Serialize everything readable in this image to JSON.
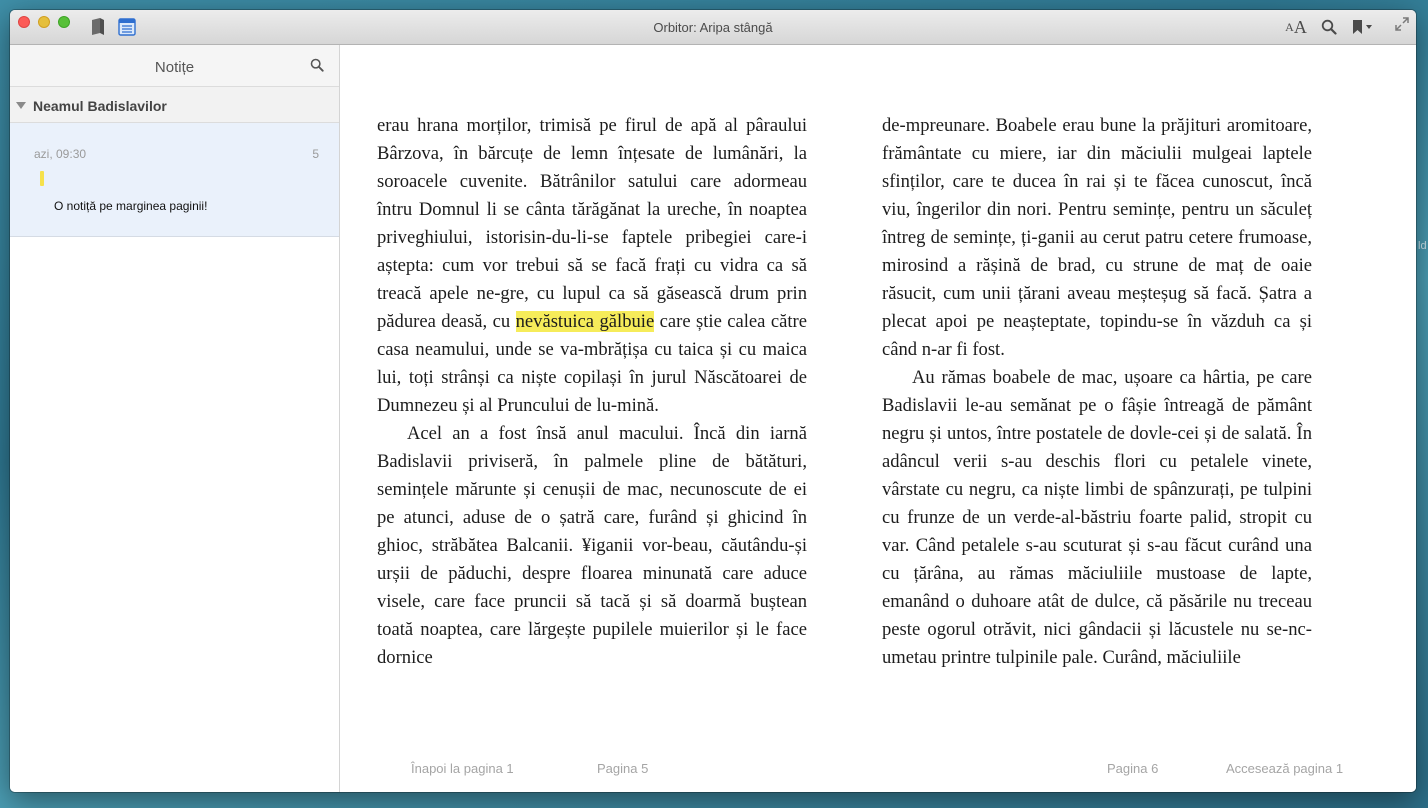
{
  "window": {
    "title": "Orbitor: Aripa stângă",
    "font_size_small": "A",
    "font_size_large": "A"
  },
  "desktop": {
    "fragment": "ld"
  },
  "sidebar": {
    "title": "Notițe",
    "chapter": "Neamul Badislavilor",
    "note": {
      "time": "azi, 09:30",
      "page": "5",
      "highlight_color": "#f6e14b",
      "text": "O notiță pe marginea paginii!"
    }
  },
  "book": {
    "left_page": {
      "p1_before": "erau hrana morților, trimisă pe firul de apă al pâraului Bârzova, în bărcuțe de lemn înțesate de lumânări, la soroacele cuvenite. Bătrânilor satului care adormeau întru Domnul li se cânta tărăgănat la ureche, în noaptea priveghiului, istorisin-du-li-se faptele pribegiei care-i aștepta: cum vor trebui să se facă frați cu vidra ca să treacă apele ne-gre, cu lupul ca să găsească drum prin pădurea deasă, cu",
      "highlight": "nevăstuica gălbuie",
      "p1_after": "care știe calea către casa neamului, unde se va-mbrățișa cu taica și cu maica lui, toți strânși ca niște copilași în jurul Născătoarei de Dumnezeu și al Pruncului de lu-mină.",
      "p2": "Acel an a fost însă anul macului. Încă din iarnă Badislavii priviseră, în palmele pline de bătături, semințele mărunte și cenușii de mac, necunoscute de ei pe atunci, aduse de o șatră care, furând și ghicind în ghioc, străbătea Balcanii. ¥iganii vor-beau, căutându-și urșii de păduchi, despre floarea minunată care aduce visele, care face pruncii să tacă și să doarmă buștean toată noaptea, care lărgește pupilele muierilor și le face dornice"
    },
    "right_page": {
      "p1": "de-mpreunare. Boabele erau bune la prăjituri aromitoare, frământate cu miere, iar din măciulii mulgeai laptele sfinților, care te ducea în rai și te făcea cunoscut, încă viu, îngerilor din nori. Pentru semințe, pentru un săculeț întreg de semințe, ți-ganii au cerut patru cetere frumoase, mirosind a rășină de brad, cu strune de maț de oaie răsucit, cum unii țărani aveau meșteșug să facă. Șatra a plecat apoi pe neașteptate, topindu-se în văzduh ca și când n-ar fi fost.",
      "p2": "Au rămas boabele de mac, ușoare ca hârtia, pe care Badislavii le-au semănat pe o fâșie întreagă de pământ negru și untos, între postatele de dovle-cei și de salată. În adâncul verii s-au deschis flori cu petalele vinete, vârstate cu negru, ca niște limbi de spânzurați, pe tulpini cu frunze de un verde-al-băstriu foarte palid, stropit cu var. Când petalele s-au scuturat și s-au făcut curând una cu țărâna, au rămas măciuliile mustoase de lapte, emanând o duhoare atât de dulce, că păsările nu treceau peste ogorul otrăvit, nici gândacii și lăcustele nu se-nc-umetau printre tulpinile pale. Curând, măciuliile"
    },
    "footer": {
      "back": "Înapoi la pagina 1",
      "left_page_num": "Pagina 5",
      "right_page_num": "Pagina 6",
      "goto": "Accesează pagina 1"
    }
  }
}
